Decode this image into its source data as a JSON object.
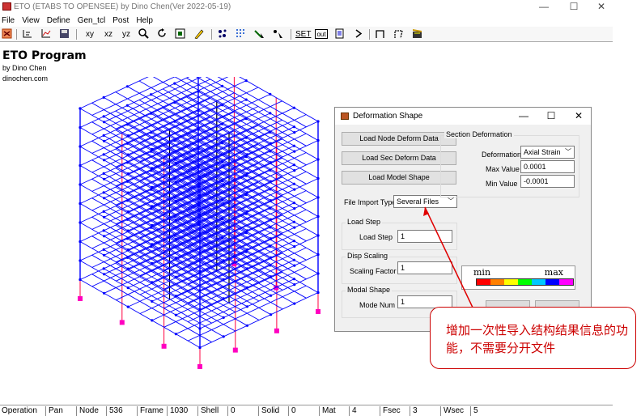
{
  "window": {
    "title": "ETO (ETABS TO OPENSEE) by Dino Chen(Ver 2022-05-19)",
    "minimize": "—",
    "maximize": "☐",
    "close": "✕"
  },
  "menu": [
    "File",
    "View",
    "Define",
    "Gen_tcl",
    "Post",
    "Help"
  ],
  "toolbar": {
    "view_xy": "xy",
    "view_xz": "xz",
    "view_yz": "yz",
    "set": "SET",
    "out": "out"
  },
  "program": {
    "name": "ETO Program",
    "author": "by Dino Chen",
    "site": "dinochen.com"
  },
  "dialog": {
    "title": "Deformation Shape",
    "load_node_btn": "Load Node Deform Data",
    "load_sec_btn": "Load Sec Deform Data",
    "load_model_btn": "Load Model Shape",
    "file_import_label": "File Import Type",
    "file_import_value": "Several Files",
    "load_step_group": "Load Step",
    "load_step_label": "Load Step",
    "load_step_value": "1",
    "disp_scaling_group": "Disp Scaling",
    "scaling_factor_label": "Scaling Factor",
    "scaling_factor_value": "1",
    "modal_group": "Modal Shape",
    "mode_num_label": "Mode Num",
    "mode_num_value": "1",
    "section_group": "Section Deformation",
    "deformation_label": "Deformation",
    "deformation_value": "Axial Strain",
    "max_value_label": "Max Value",
    "max_value": "0.0001",
    "min_value_label": "Min Value",
    "min_value": "-0.0001",
    "legend_min": "min",
    "legend_max": "max",
    "legend_colors": [
      "#ff0000",
      "#ff8000",
      "#ffff00",
      "#00ff00",
      "#00c8ff",
      "#0000ff",
      "#ff00ff"
    ]
  },
  "callout": {
    "text": "增加一次性导入结构结果信息的功能，不需要分开文件"
  },
  "status": {
    "operation_label": "Operation",
    "operation_value": "Pan",
    "node_label": "Node",
    "node_value": "536",
    "frame_label": "Frame",
    "frame_value": "1030",
    "shell_label": "Shell",
    "shell_value": "0",
    "solid_label": "Solid",
    "solid_value": "0",
    "mat_label": "Mat",
    "mat_value": "4",
    "fsec_label": "Fsec",
    "fsec_value": "3",
    "wsec_label": "Wsec",
    "wsec_value": "5"
  },
  "colors": {
    "frame": "#0000ff",
    "column": "#ff0040",
    "support": "#ff00c0",
    "callout": "#cc0000"
  }
}
